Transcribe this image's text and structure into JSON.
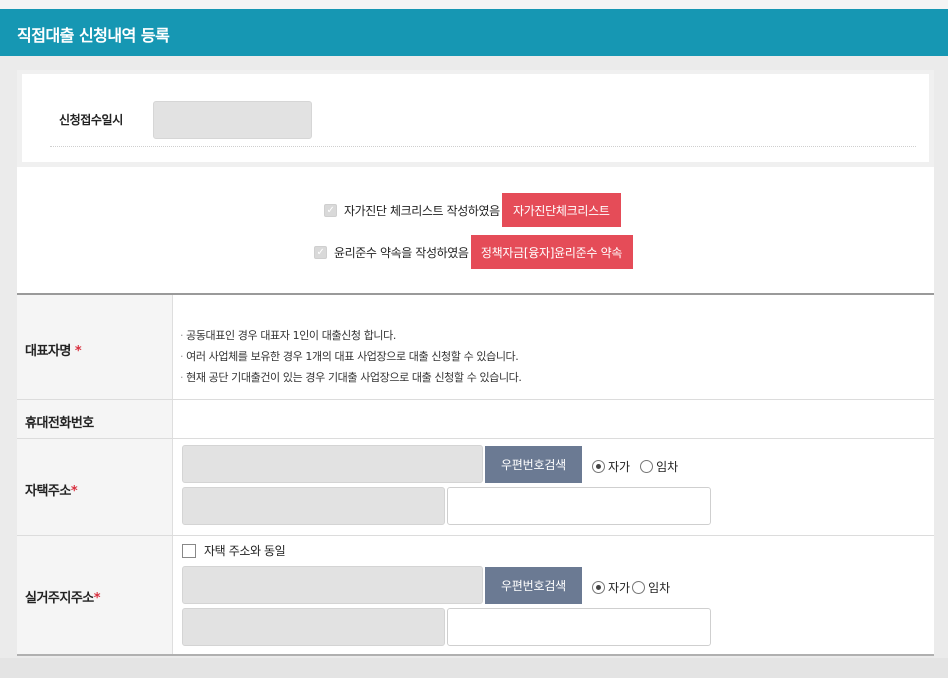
{
  "header": {
    "title": "직접대출 신청내역 등록"
  },
  "reception": {
    "label": "신청접수일시",
    "value": ""
  },
  "agreements": {
    "selfcheck": {
      "checked": true,
      "label": "자가진단 체크리스트 작성하였음",
      "button": "자가진단체크리스트"
    },
    "ethics": {
      "checked": true,
      "label": "윤리준수 약속을 작성하였음",
      "button": "정책자금[융자]윤리준수 약속"
    }
  },
  "form": {
    "rep_name": {
      "label": "대표자명",
      "required_mark": "*",
      "notes": [
        "공동대표인 경우 대표자 1인이 대출신청 합니다.",
        "여러 사업체를 보유한 경우 1개의 대표 사업장으로 대출 신청할 수 있습니다.",
        "현재 공단 기대출건이 있는 경우 기대출 사업장으로 대출 신청할 수 있습니다."
      ]
    },
    "mobile": {
      "label": "휴대전화번호"
    },
    "home_address": {
      "label": "자택주소",
      "required_mark": "*",
      "zip_button": "우편번호검색",
      "ownership": {
        "options": [
          "자가",
          "임차"
        ],
        "selected": "자가"
      }
    },
    "actual_address": {
      "label": "실거주지주소",
      "required_mark": "*",
      "same_as_home": {
        "checked": false,
        "label": "자택 주소와 동일"
      },
      "zip_button": "우편번호검색",
      "ownership": {
        "options": [
          "자가",
          "임차"
        ],
        "selected": "자가"
      }
    }
  },
  "colors": {
    "header": "#1697b3",
    "red_button": "#e54c58",
    "zip_button": "#6b7a93",
    "required": "#d9303f"
  }
}
